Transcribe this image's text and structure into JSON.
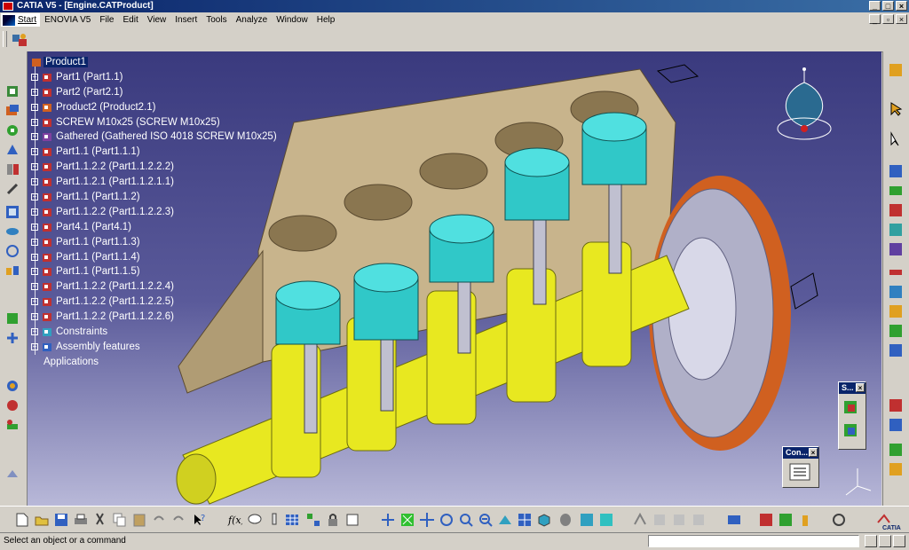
{
  "window": {
    "title": "CATIA V5 - [Engine.CATProduct]"
  },
  "menu": {
    "start": "Start",
    "items": [
      "ENOVIA V5",
      "File",
      "Edit",
      "View",
      "Insert",
      "Tools",
      "Analyze",
      "Window",
      "Help"
    ]
  },
  "tree": {
    "root": "Product1",
    "items": [
      {
        "label": "Part1 (Part1.1)",
        "icon": "part-icon"
      },
      {
        "label": "Part2 (Part2.1)",
        "icon": "part-icon"
      },
      {
        "label": "Product2 (Product2.1)",
        "icon": "product-icon"
      },
      {
        "label": "SCREW M10x25 (SCREW M10x25)",
        "icon": "part-icon"
      },
      {
        "label": "Gathered (Gathered ISO 4018 SCREW M10x25)",
        "icon": "gathered-icon"
      },
      {
        "label": "Part1.1 (Part1.1.1)",
        "icon": "part-icon"
      },
      {
        "label": "Part1.1.2.2 (Part1.1.2.2.2)",
        "icon": "part-icon"
      },
      {
        "label": "Part1.1.2.1 (Part1.1.2.1.1)",
        "icon": "part-icon"
      },
      {
        "label": "Part1.1 (Part1.1.2)",
        "icon": "part-icon"
      },
      {
        "label": "Part1.1.2.2 (Part1.1.2.2.3)",
        "icon": "part-icon"
      },
      {
        "label": "Part4.1 (Part4.1)",
        "icon": "part-icon"
      },
      {
        "label": "Part1.1 (Part1.1.3)",
        "icon": "part-icon"
      },
      {
        "label": "Part1.1 (Part1.1.4)",
        "icon": "part-icon"
      },
      {
        "label": "Part1.1 (Part1.1.5)",
        "icon": "part-icon"
      },
      {
        "label": "Part1.1.2.2 (Part1.1.2.2.4)",
        "icon": "part-icon"
      },
      {
        "label": "Part1.1.2.2 (Part1.1.2.2.5)",
        "icon": "part-icon"
      },
      {
        "label": "Part1.1.2.2 (Part1.1.2.2.6)",
        "icon": "part-icon"
      },
      {
        "label": "Constraints",
        "icon": "constraints-icon"
      },
      {
        "label": "Assembly features",
        "icon": "assembly-features-icon"
      },
      {
        "label": "Applications",
        "icon": ""
      }
    ]
  },
  "toolboxes": {
    "s_title": "S...",
    "con_title": "Con..."
  },
  "status": {
    "message": "Select an object or a command"
  },
  "colors": {
    "accent": "#0a246a",
    "piston": "#30c8c8",
    "crank": "#e8e820",
    "block": "#c8b48c",
    "gear": "#d06020"
  }
}
